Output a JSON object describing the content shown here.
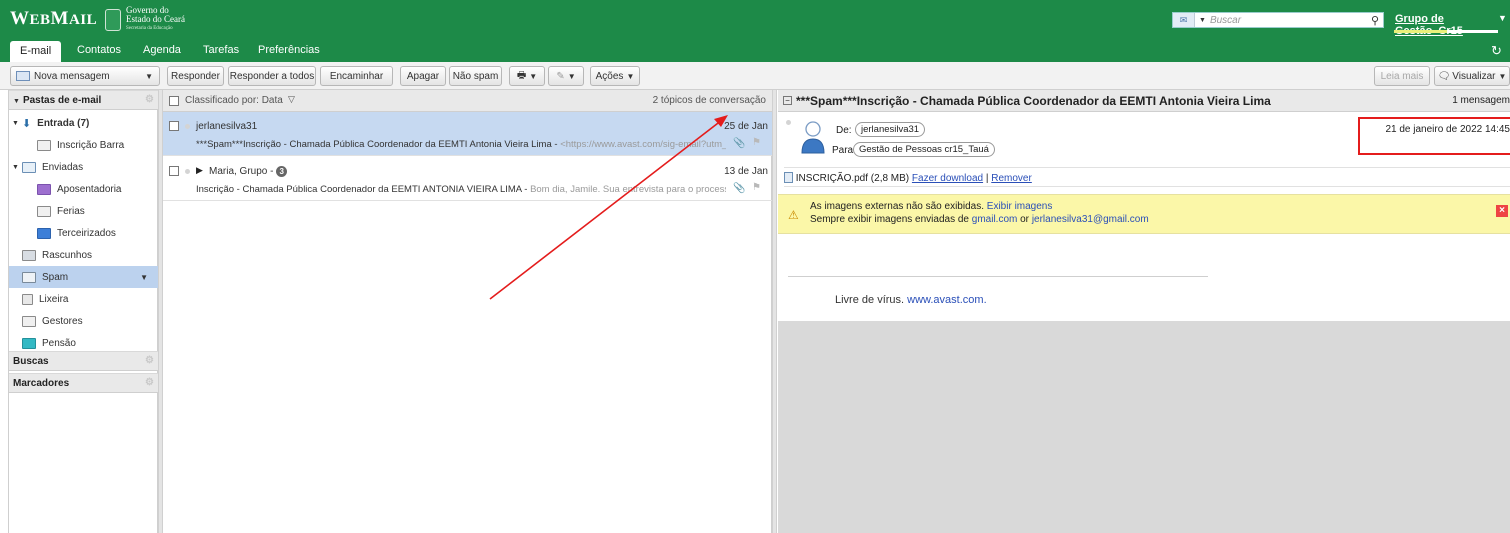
{
  "brand": {
    "logo_big_w": "W",
    "logo_rest": "EB",
    "logo_big_m": "M",
    "logo_rest2": "AIL",
    "gov_line1": "Governo do",
    "gov_line2": "Estado do Ceará",
    "gov_line3": "Secretaria da Educação"
  },
  "header": {
    "search_placeholder": "Buscar",
    "user_name": "Grupo de Gestão_Cr15"
  },
  "tabs": [
    {
      "label": "E-mail",
      "active": true
    },
    {
      "label": "Contatos"
    },
    {
      "label": "Agenda"
    },
    {
      "label": "Tarefas"
    },
    {
      "label": "Preferências"
    }
  ],
  "toolbar": {
    "new_message": "Nova mensagem",
    "reply": "Responder",
    "reply_all": "Responder a todos",
    "forward": "Encaminhar",
    "delete": "Apagar",
    "not_spam": "Não spam",
    "actions": "Ações",
    "read_more": "Leia mais",
    "view": "Visualizar"
  },
  "sidebar": {
    "folders_header": "Pastas de e-mail",
    "folders": [
      {
        "label": "Entrada (7)",
        "icon": "inbox-icon"
      },
      {
        "label": "Inscrição Barra",
        "icon": "folder-icon"
      },
      {
        "label": "Enviadas",
        "icon": "sent-icon"
      },
      {
        "label": "Aposentadoria",
        "icon": "folder-purple-icon"
      },
      {
        "label": "Ferias",
        "icon": "folder-icon"
      },
      {
        "label": "Terceirizados",
        "icon": "folder-blue-icon"
      },
      {
        "label": "Rascunhos",
        "icon": "drafts-icon"
      },
      {
        "label": "Spam",
        "icon": "spam-icon"
      },
      {
        "label": "Lixeira",
        "icon": "trash-icon"
      },
      {
        "label": "Gestores",
        "icon": "folder-icon"
      },
      {
        "label": "Pensão",
        "icon": "folder-teal-icon"
      }
    ],
    "searches_header": "Buscas",
    "tags_header": "Marcadores"
  },
  "list": {
    "sort_label": "Classificado por: Data",
    "topic_count": "2 tópicos de conversação",
    "rows": [
      {
        "from": "jerlanesilva31",
        "date": "25 de Jan",
        "subject": "***Spam***Inscrição - Chamada Pública Coordenador da EEMTI Antonia Vieira Lima - ",
        "fragment": "<https://www.avast.com/sig-email?utm_m"
      },
      {
        "from": "Maria, Grupo - ",
        "badge": "3",
        "date": "13 de Jan",
        "subject": "Inscrição - Chamada Pública Coordenador da EEMTI ANTONIA VIEIRA LIMA - ",
        "fragment": "Bom dia, Jamile. Sua entrevista para o processo sel"
      }
    ]
  },
  "reader": {
    "title": "***Spam***Inscrição - Chamada Pública Coordenador da EEMTI Antonia Vieira Lima",
    "count": "1 mensagem",
    "from_label": "De:",
    "from": "jerlanesilva31",
    "to_label": "Para:",
    "to": "Gestão de Pessoas cr15_Tauá",
    "date": "21 de janeiro de 2022 14:45",
    "attachment_name": "INSCRIÇÃO.pdf (2,8 MB)",
    "download": "Fazer download",
    "separator": "|",
    "remove": "Remover",
    "notice_line1": "As imagens externas não são exibidas.",
    "show_images": "Exibir imagens",
    "notice_line2": "Sempre exibir imagens enviadas de",
    "sender_domain": "gmail.com",
    "or": "or",
    "sender_email": "jerlanesilva31@gmail.com",
    "virus_free": "Livre de vírus.",
    "avast_link": "www.avast.com."
  },
  "colors": {
    "brand_green": "#1d8a48",
    "annotation_red": "#e41c1c",
    "selected_row": "#c6d9f1"
  }
}
